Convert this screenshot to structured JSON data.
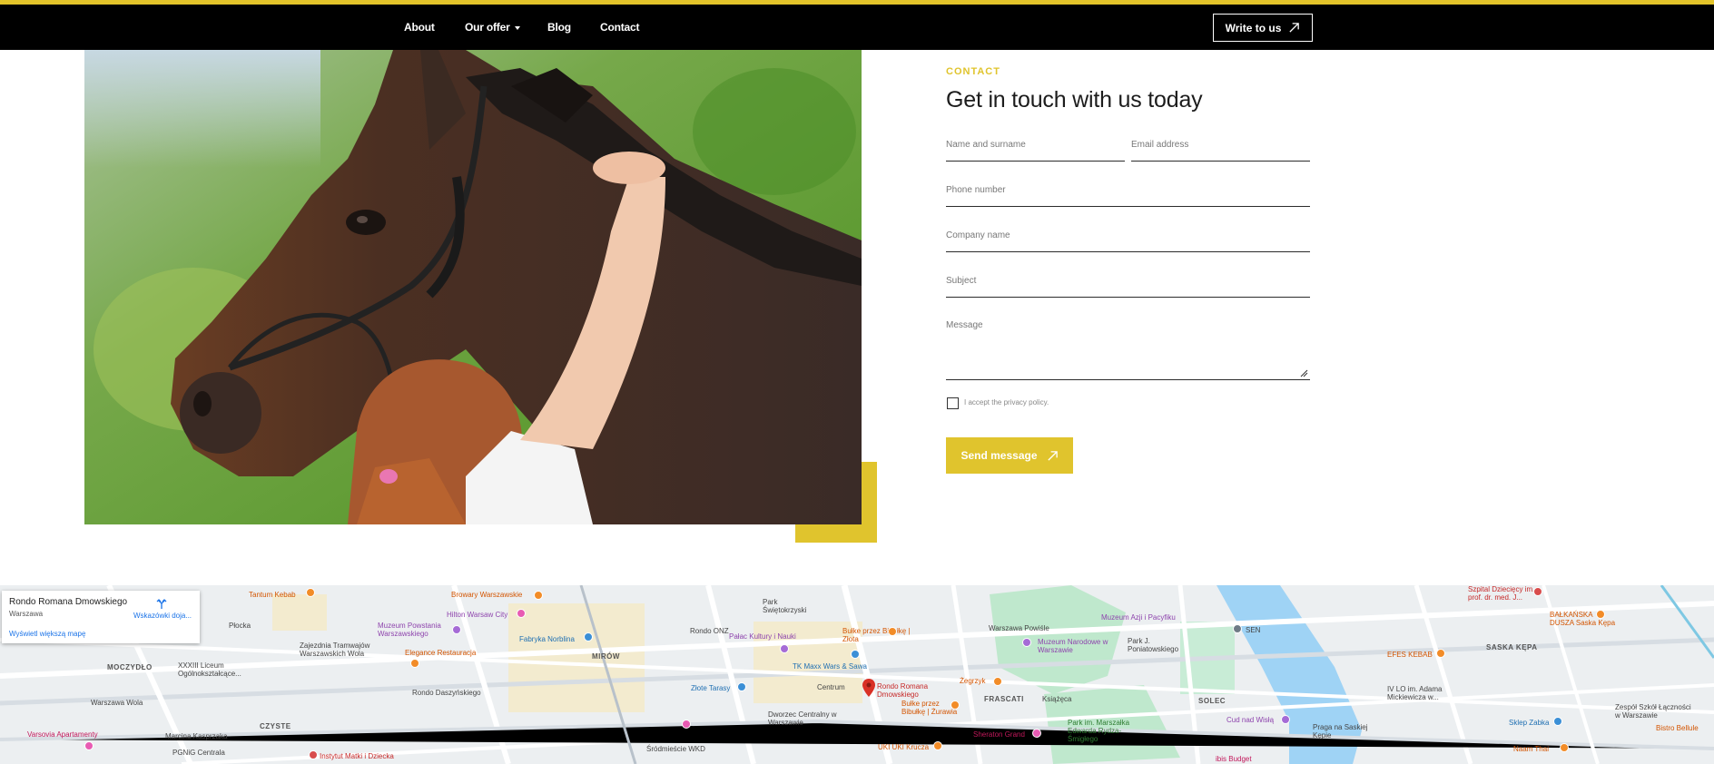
{
  "colors": {
    "accent": "#e0c42d",
    "nav_bg": "#000000",
    "text": "#1c1c1c"
  },
  "nav": {
    "items": [
      {
        "label": "About"
      },
      {
        "label": "Our offer"
      },
      {
        "label": "Blog"
      },
      {
        "label": "Contact"
      }
    ],
    "cta_label": "Write to us"
  },
  "contact": {
    "eyebrow": "CONTACT",
    "heading": "Get in touch with us today",
    "fields": {
      "name": "Name and surname",
      "email": "Email address",
      "phone": "Phone number",
      "company": "Company name",
      "subject": "Subject",
      "message": "Message"
    },
    "privacy_label": "I accept the privacy policy.",
    "send_label": "Send message"
  },
  "map": {
    "card_title": "Rondo Romana Dmowskiego",
    "card_subtitle": "Warszawa",
    "card_link": "Wyświetl większą mapę",
    "directions_label": "Wskazówki doja...",
    "labels": {
      "tantum": "Tantum Kebab",
      "browary": "Browary Warszawskie",
      "hilton": "Hilton Warsaw City",
      "plocka": "Płocka",
      "muzeum_pow": "Muzeum Powstania Warszawskiego",
      "zajezdnia": "Zajezdnia Tramwajów Warszawskich Wola",
      "fabryka": "Fabryka Norblina",
      "rondo_onz": "Rondo ONZ",
      "palac": "Pałac Kultury i Nauki",
      "bulke1": "Bułke przez Bibułkę | Złota",
      "swietokrzyski": "Park Świętokrzyski",
      "warszawa_powisle": "Warszawa Powiśle",
      "muzeum_azji": "Muzeum Azji i Pacyfiku",
      "sen": "SEN",
      "szpital": "Szpital Dziecięcy im. prof. dr. med. J...",
      "balkanska": "BAŁKAŃSKA DUSZA Saska Kępa",
      "moczydlo": "MOCZYDŁO",
      "xxxiii": "XXXIII Liceum Ogólnokształcące...",
      "elegance": "Elegance Restauracja",
      "mirow": "MIRÓW",
      "tk_maxx": "TK Maxx Wars & Sawa",
      "muzeum_nar": "Muzeum Narodowe w Warszawie",
      "park_pon": "Park J. Poniatowskiego",
      "efes": "EFES KEBAB",
      "saska": "SASKA KĘPA",
      "warszawa_wola": "Warszawa Wola",
      "rondo_dasz": "Rondo Daszyńskiego",
      "zlote": "Złote Tarasy",
      "centrum": "Centrum",
      "rondo_dm": "Rondo Romana Dmowskiego",
      "zegrzyk": "Żegrzyk",
      "frascati": "FRASCATI",
      "ksiazeca": "Książęca",
      "solec": "SOLEC",
      "liceum_iv": "IV LO im. Adama Mickiewicza w...",
      "zespol": "Zespół Szkół Łączności w Warszawie",
      "varsovia": "Varsovia Apartamenty",
      "czyste": "CZYSTE",
      "kasprzaka": "Marcina Kasprzaka",
      "dworzec": "Dworzec Centralny w Warszawie",
      "bulke2": "Bułke przez Bibułkę | Żurawia",
      "sheraton": "Sheraton Grand",
      "cud": "Cud nad Wisłą",
      "praga": "Praga na Saskiej Kępie",
      "sklep": "Sklep Zabka",
      "bistro": "Bistro Bellule",
      "pgnig": "PGNiG Centrala",
      "instytut": "Instytut Matki i Dziecka",
      "srodmiescie": "Śródmieście WKD",
      "uki": "UKI UKI Krucza",
      "park_rydz": "Park im. Marszałka Edwarda Rydza-Śmigłego",
      "ibis": "ibis Budget",
      "naam": "Naam Thai",
      "warszawa_city": "Warszawa"
    }
  }
}
